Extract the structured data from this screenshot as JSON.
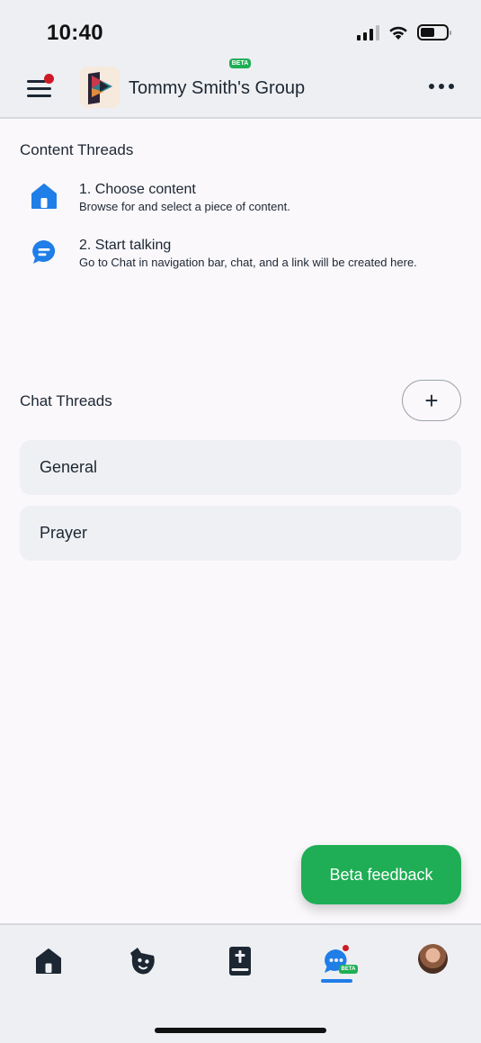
{
  "status_bar": {
    "time": "10:40"
  },
  "header": {
    "group_name": "Tommy Smith's Group",
    "beta_badge": "BETA",
    "menu_icon": "hamburger-menu-icon",
    "more_icon": "more-horizontal-icon",
    "notification_color": "#cc1b27"
  },
  "content_threads": {
    "title": "Content Threads",
    "steps": [
      {
        "icon": "home-icon",
        "title": "1. Choose content",
        "description": "Browse for and select a piece of content."
      },
      {
        "icon": "chat-bubble-icon",
        "title": "2. Start talking",
        "description": "Go to Chat in navigation bar, chat, and a link will be created here."
      }
    ]
  },
  "chat_threads": {
    "title": "Chat Threads",
    "add_label": "+",
    "items": [
      {
        "label": "General"
      },
      {
        "label": "Prayer"
      }
    ]
  },
  "feedback_button": {
    "label": "Beta feedback",
    "color": "#1fae55"
  },
  "bottom_nav": {
    "items": [
      {
        "icon": "home-icon"
      },
      {
        "icon": "mask-icon"
      },
      {
        "icon": "bible-icon"
      },
      {
        "icon": "chat-icon",
        "active": true,
        "badge": "BETA"
      },
      {
        "icon": "profile-avatar"
      }
    ],
    "accent_color": "#1f7ee8"
  }
}
